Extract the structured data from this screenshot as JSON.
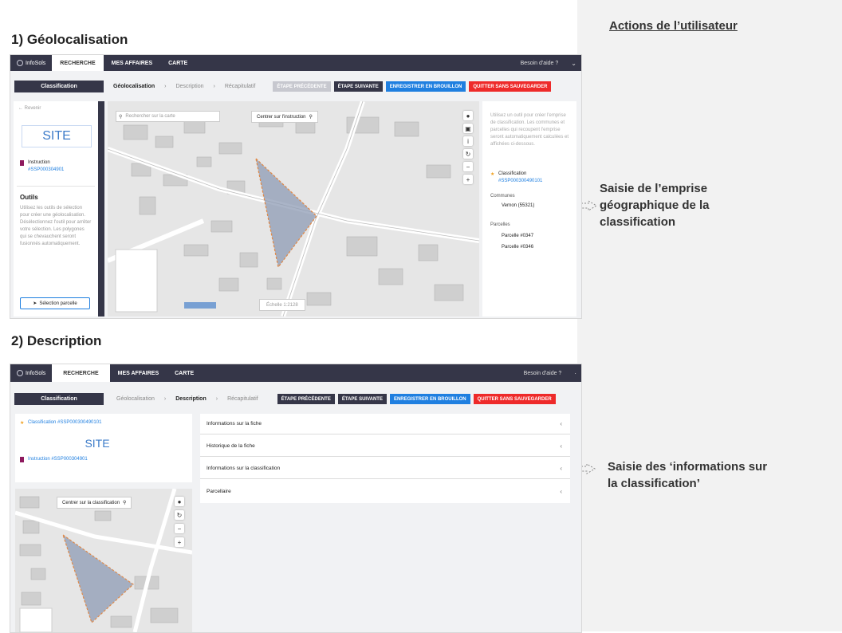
{
  "section1": {
    "title": "1) Géolocalisation"
  },
  "section2": {
    "title": "2) Description"
  },
  "right_panel": {
    "heading": "Actions de l’utilisateur",
    "note1": [
      "Saisie de l’emprise",
      "géographique de la",
      "classification"
    ],
    "note2": [
      "Saisie des ‘informations sur",
      "la classification’"
    ]
  },
  "app": {
    "logo": "InfoSols",
    "tabs": [
      "RECHERCHE",
      "MES AFFAIRES",
      "CARTE"
    ],
    "help": "Besoin d'aide ?",
    "classification_label": "Classification",
    "steps": [
      "Géolocalisation",
      "Description",
      "Récapitulatif"
    ],
    "buttons": {
      "prev": "ÉTAPE PRÉCÉDENTE",
      "next": "ÉTAPE SUIVANTE",
      "draft": "ENREGISTRER EN BROUILLON",
      "quit": "QUITTER SANS SAUVEGARDER"
    },
    "site": "SITE"
  },
  "geo": {
    "back": "← Revenir",
    "instruction_label": "Instruction",
    "instruction_id": "#SSP000304901",
    "tools_title": "Outils",
    "tools_text": "Utilisez les outils de sélection pour créer une géolocalisation. Désélectionnez l'outil pour arrêter votre sélection. Les polygones qui se chevauchent seront fusionnés automatiquement.",
    "select_parcel": "Sélection parcelle",
    "search_placeholder": "Rechercher sur la carte",
    "center_btn": "Centrer sur l'instruction",
    "scale": "Échelle 1:2128",
    "info_text": "Utilisez un outil pour créer l'emprise de classification. Les communes et parcelles qui recoupent l'emprise seront automatiquement calculées et affichées ci-dessous.",
    "classification_label": "Classification",
    "classification_id": "#SSP000300490101",
    "communes_label": "Communes",
    "commune": "Vernon (55321)",
    "parcelles_label": "Parcelles",
    "parcelles": [
      "Parcelle #0347",
      "Parcelle #0346"
    ]
  },
  "desc": {
    "classification": "Classification #SSP000300490101",
    "instruction": "Instruction #SSP000304901",
    "center_btn": "Centrer sur la classification",
    "rows": [
      "Informations sur la fiche",
      "Historique de la fiche",
      "Informations sur la classification",
      "Parcellaire"
    ]
  }
}
